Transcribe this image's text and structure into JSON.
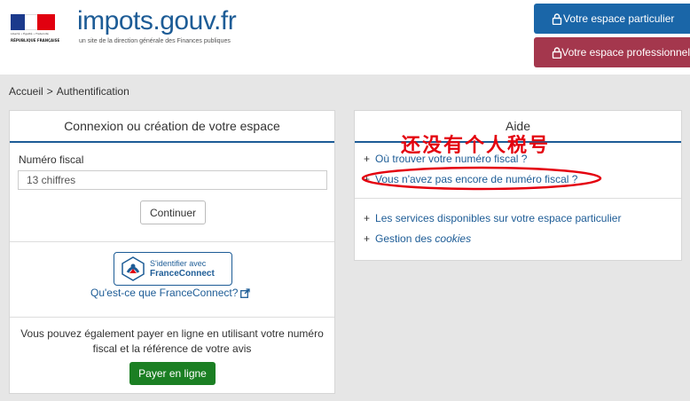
{
  "header": {
    "rf_motto": "Liberté • Égalité • Fraternité",
    "rf_name": "RÉPUBLIQUE FRANÇAISE",
    "logo": "impots.gouv.fr",
    "tagline": "un site de la direction générale des Finances publiques",
    "btn_particulier": "Votre espace particulier",
    "btn_professionnel": "Votre espace professionnel"
  },
  "breadcrumb": {
    "home": "Accueil",
    "separator": ">",
    "current": "Authentification"
  },
  "login": {
    "title": "Connexion ou création de votre espace",
    "field_label": "Numéro fiscal",
    "field_placeholder": "13 chiffres",
    "continue_label": "Continuer",
    "fc_line1": "S'identifier avec",
    "fc_line2": "FranceConnect",
    "fc_link": "Qu'est-ce que FranceConnect?",
    "pay_text": "Vous pouvez également payer en ligne en utilisant votre numéro fiscal et la référence de votre avis",
    "pay_label": "Payer en ligne"
  },
  "aide": {
    "title": "Aide",
    "links": [
      "Où trouver votre numéro fiscal ?",
      "Vous n'avez pas encore de numéro fiscal ?",
      "Les services disponibles sur votre espace particulier"
    ],
    "cookies_prefix": "Gestion des ",
    "cookies_em": "cookies"
  },
  "annotation": {
    "text": "还没有个人税号",
    "color": "#e4000e"
  },
  "colors": {
    "brand_blue": "#1d5c96",
    "particulier": "#1a66a8",
    "professionnel": "#a4374d",
    "pay_green": "#1b7f23"
  },
  "icons": [
    "lock-icon",
    "external-link-icon",
    "franceconnect-logo",
    "marianne-logo"
  ]
}
